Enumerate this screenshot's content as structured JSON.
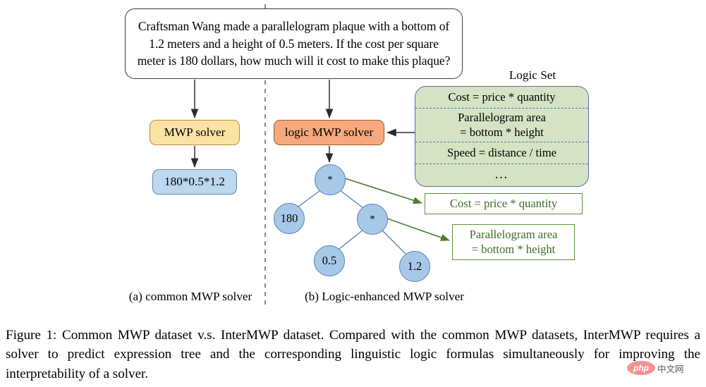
{
  "figure": {
    "problem_text": "Craftsman Wang made a parallelogram plaque with a bottom of 1.2 meters and a height of 0.5 meters. If the cost per square meter is 180 dollars, how much will it cost to make this plaque?",
    "caption": "Figure 1: Common MWP dataset v.s. InterMWP dataset. Compared with the common MWP datasets, InterMWP requires a solver to predict expression tree and the corresponding linguistic logic formulas simultaneously for improving the interpretability of a solver."
  },
  "left_panel": {
    "solver_label": "MWP solver",
    "answer_label": "180*0.5*1.2",
    "subcaption": "(a) common MWP solver",
    "solver_color": "#fce3a4",
    "answer_color": "#bdd7ee"
  },
  "right_panel": {
    "solver_label": "logic MWP solver",
    "subcaption": "(b) Logic-enhanced MWP solver",
    "solver_color": "#f5a97c"
  },
  "logic_set": {
    "title": "Logic Set",
    "box_color": "#d5e3c4",
    "border_color": "#4f74a8",
    "rows": [
      "Cost = price  * quantity",
      "Parallelogram area\n= bottom * height",
      "Speed = distance  / time",
      "…"
    ]
  },
  "tree": {
    "nodes": [
      {
        "id": "root",
        "label": "*"
      },
      {
        "id": "left",
        "label": "180"
      },
      {
        "id": "mul2",
        "label": "*"
      },
      {
        "id": "l05",
        "label": "0.5"
      },
      {
        "id": "l12",
        "label": "1.2"
      }
    ],
    "node_color": "#a7c8e8",
    "edge_color": "#5580b4"
  },
  "callouts": {
    "color": "#3c6b2a",
    "border_color": "#5f8f3d",
    "items": [
      "Cost = price  * quantity",
      "Parallelogram area\n= bottom * height"
    ]
  },
  "watermark": {
    "logo_text": "php",
    "site_text": "中文网"
  }
}
